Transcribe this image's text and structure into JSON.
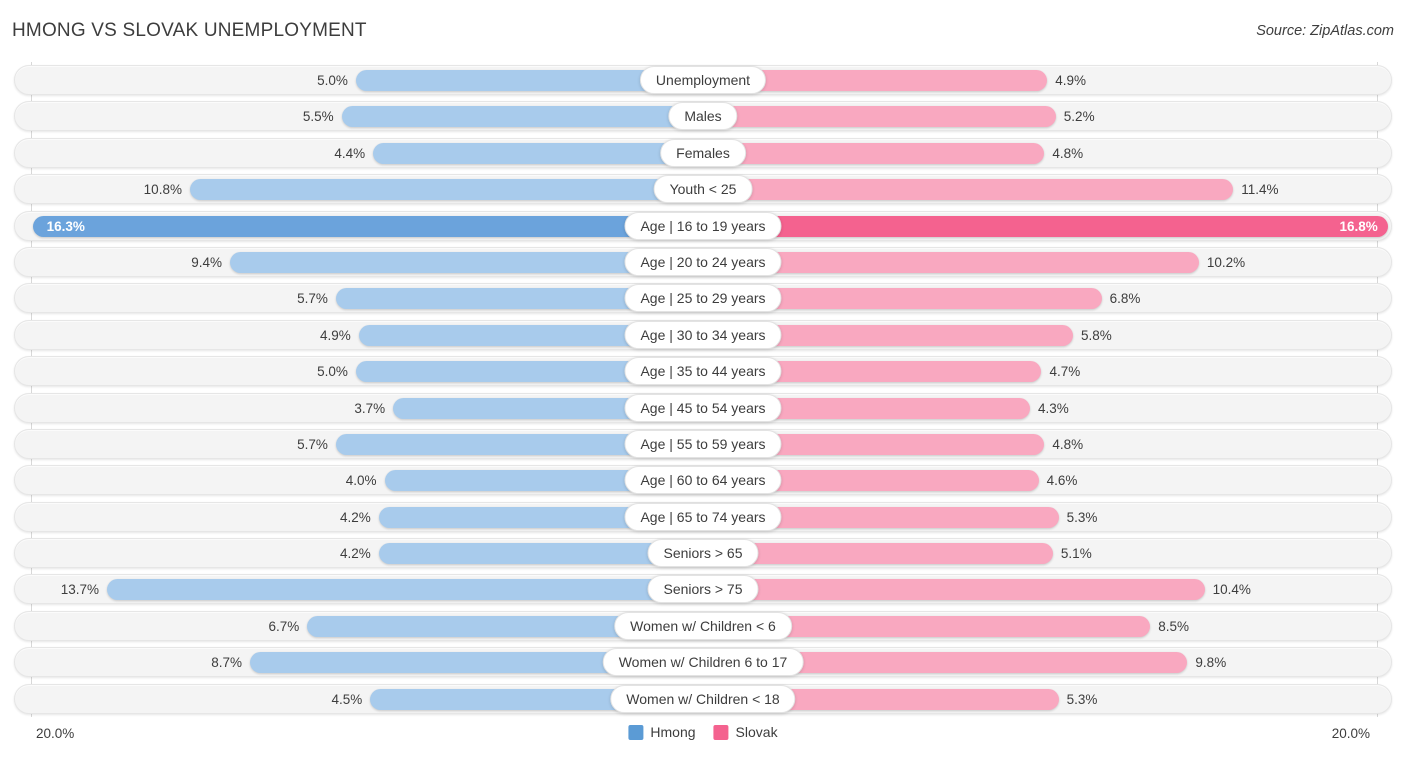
{
  "header": {
    "title": "HMONG VS SLOVAK UNEMPLOYMENT",
    "source": "Source: ZipAtlas.com"
  },
  "axis": {
    "left_end": "20.0%",
    "right_end": "20.0%",
    "max": 20.0
  },
  "legend": {
    "items": [
      {
        "label": "Hmong",
        "color": "#5B9BD5"
      },
      {
        "label": "Slovak",
        "color": "#F4628F"
      }
    ]
  },
  "colors": {
    "left_light": "#A8CBEC",
    "left_dark": "#6BA3DC",
    "right_light": "#F9A8C0",
    "right_dark": "#F4628F",
    "track": "#f4f4f4",
    "track_border": "#e6e6e6"
  },
  "chart_data": {
    "type": "bar",
    "title": "HMONG VS SLOVAK UNEMPLOYMENT",
    "subtitle": "Source: ZipAtlas.com",
    "orientation": "horizontal-diverging",
    "xlabel": "",
    "ylabel": "",
    "xlim": [
      20.0,
      20.0
    ],
    "grid": false,
    "legend_position": "bottom-center",
    "categories": [
      "Unemployment",
      "Males",
      "Females",
      "Youth < 25",
      "Age | 16 to 19 years",
      "Age | 20 to 24 years",
      "Age | 25 to 29 years",
      "Age | 30 to 34 years",
      "Age | 35 to 44 years",
      "Age | 45 to 54 years",
      "Age | 55 to 59 years",
      "Age | 60 to 64 years",
      "Age | 65 to 74 years",
      "Seniors > 65",
      "Seniors > 75",
      "Women w/ Children < 6",
      "Women w/ Children 6 to 17",
      "Women w/ Children < 18"
    ],
    "series": [
      {
        "name": "Hmong",
        "side": "left",
        "values": [
          5.0,
          5.5,
          4.4,
          10.8,
          16.3,
          9.4,
          5.7,
          4.9,
          5.0,
          3.7,
          5.7,
          4.0,
          4.2,
          4.2,
          13.7,
          6.7,
          8.7,
          4.5
        ]
      },
      {
        "name": "Slovak",
        "side": "right",
        "values": [
          4.9,
          5.2,
          4.8,
          11.4,
          16.8,
          10.2,
          6.8,
          5.8,
          4.7,
          4.3,
          4.8,
          4.6,
          5.3,
          5.1,
          10.4,
          8.5,
          9.8,
          5.3
        ]
      }
    ]
  },
  "rows": [
    {
      "label": "Unemployment",
      "left": "5.0%",
      "right": "4.9%",
      "left_val": 5.0,
      "right_val": 4.9
    },
    {
      "label": "Males",
      "left": "5.5%",
      "right": "5.2%",
      "left_val": 5.5,
      "right_val": 5.2
    },
    {
      "label": "Females",
      "left": "4.4%",
      "right": "4.8%",
      "left_val": 4.4,
      "right_val": 4.8
    },
    {
      "label": "Youth < 25",
      "left": "10.8%",
      "right": "11.4%",
      "left_val": 10.8,
      "right_val": 11.4
    },
    {
      "label": "Age | 16 to 19 years",
      "left": "16.3%",
      "right": "16.8%",
      "left_val": 16.3,
      "right_val": 16.8
    },
    {
      "label": "Age | 20 to 24 years",
      "left": "9.4%",
      "right": "10.2%",
      "left_val": 9.4,
      "right_val": 10.2
    },
    {
      "label": "Age | 25 to 29 years",
      "left": "5.7%",
      "right": "6.8%",
      "left_val": 5.7,
      "right_val": 6.8
    },
    {
      "label": "Age | 30 to 34 years",
      "left": "4.9%",
      "right": "5.8%",
      "left_val": 4.9,
      "right_val": 5.8
    },
    {
      "label": "Age | 35 to 44 years",
      "left": "5.0%",
      "right": "4.7%",
      "left_val": 5.0,
      "right_val": 4.7
    },
    {
      "label": "Age | 45 to 54 years",
      "left": "3.7%",
      "right": "4.3%",
      "left_val": 3.7,
      "right_val": 4.3
    },
    {
      "label": "Age | 55 to 59 years",
      "left": "5.7%",
      "right": "4.8%",
      "left_val": 5.7,
      "right_val": 4.8
    },
    {
      "label": "Age | 60 to 64 years",
      "left": "4.0%",
      "right": "4.6%",
      "left_val": 4.0,
      "right_val": 4.6
    },
    {
      "label": "Age | 65 to 74 years",
      "left": "4.2%",
      "right": "5.3%",
      "left_val": 4.2,
      "right_val": 5.3
    },
    {
      "label": "Seniors > 65",
      "left": "4.2%",
      "right": "5.1%",
      "left_val": 4.2,
      "right_val": 5.1
    },
    {
      "label": "Seniors > 75",
      "left": "13.7%",
      "right": "10.4%",
      "left_val": 13.7,
      "right_val": 10.4
    },
    {
      "label": "Women w/ Children < 6",
      "left": "6.7%",
      "right": "8.5%",
      "left_val": 6.7,
      "right_val": 8.5
    },
    {
      "label": "Women w/ Children 6 to 17",
      "left": "8.7%",
      "right": "9.8%",
      "left_val": 8.7,
      "right_val": 9.8
    },
    {
      "label": "Women w/ Children < 18",
      "left": "4.5%",
      "right": "5.3%",
      "left_val": 4.5,
      "right_val": 5.3
    }
  ]
}
